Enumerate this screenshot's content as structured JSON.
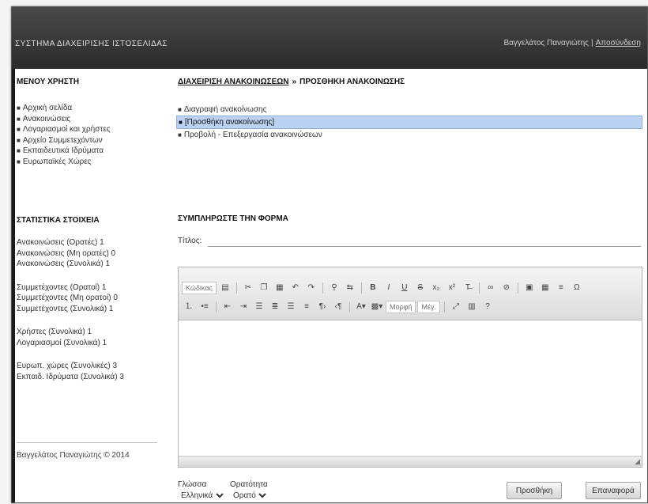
{
  "header": {
    "app_title": "ΣΥΣΤΗΜΑ ΔΙΑΧΕΙΡΙΣΗΣ ΙΣΤΟΣΕΛΙΔΑΣ",
    "user_name": "Βαγγελάτος Παναγιώτης",
    "separator": "|",
    "logout_label": "Αποσύνδεση"
  },
  "sidebar": {
    "menu_heading": "ΜΕΝΟΥ ΧΡΗΣΤΗ",
    "menu_items": [
      "Αρχική σελίδα",
      "Ανακοινώσεις",
      "Λογαριασμοί και χρήστες",
      "Αρχείο Συμμετεχόντων",
      "Εκπαιδευτικά Ιδρύματα",
      "Ευρωπαϊκές Χώρες"
    ],
    "stats_heading": "ΣΤΑΤΙΣΤΙΚΑ ΣΤΟΙΧΕΙΑ",
    "stats": [
      "Ανακοινώσεις (Ορατές) 1",
      "Ανακοινώσεις (Μη ορατές) 0",
      "Ανακοινώσεις (Συνολικά) 1",
      "Συμμετέχοντες (Ορατοί) 1",
      "Συμμετέχοντες (Μη ορατοί) 0",
      "Συμμετέχοντες (Συνολικά) 1",
      "Χρήστες (Συνολικά) 1",
      "Λογαριασμοί (Συνολικά) 1",
      "Ευρωπ. χώρες (Συνολικές) 3",
      "Εκπαιδ. Ιδρύματα (Συνολικά) 3"
    ],
    "footer": "Βαγγελάτος Παναγιώτης © 2014"
  },
  "main": {
    "breadcrumb_link": "ΔΙΑΧΕΙΡΙΣΗ ΑΝΑΚΟΙΝΩΣΕΩΝ",
    "breadcrumb_sep": "»",
    "breadcrumb_current": "ΠΡΟΣΘΗΚΗ ΑΝΑΚΟΙΝΩΣΗΣ",
    "actions": [
      "Διαγραφή ανακοίνωσης",
      "[Προσθήκη ανακοίνωσης]",
      "Προβολή - Επεξεργασία ανακοινώσεων"
    ],
    "form_heading": "ΣΥΜΠΛΗΡΩΣΤΕ ΤΗΝ ΦΟΡΜΑ",
    "title_label": "Τίτλος:",
    "title_value": "",
    "editor": {
      "source_label": "Κώδικας",
      "format_label": "Μορφή",
      "size_label": "Μέγ.",
      "resize_icon": "◢"
    },
    "language": {
      "label": "Γλώσσα",
      "value": "Ελληνικά"
    },
    "visibility": {
      "label": "Ορατότητα",
      "value": "Ορατό"
    },
    "add_button": "Προσθήκη",
    "cancel_button": "Επαναφορά"
  }
}
